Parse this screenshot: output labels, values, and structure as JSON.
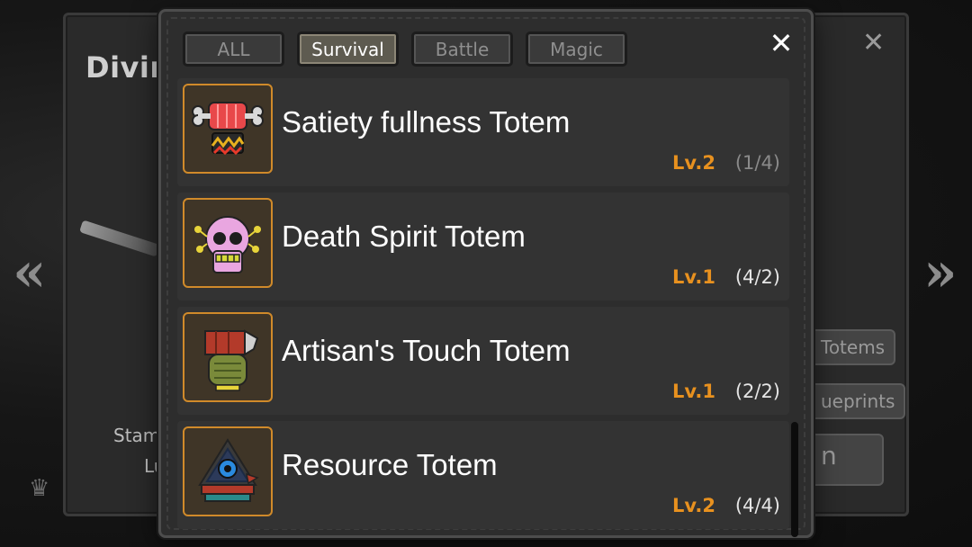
{
  "background": {
    "title": "Divin",
    "side_labels": [
      "Stam",
      "Lu"
    ],
    "buttons": [
      "Totems",
      "ueprints",
      "n"
    ]
  },
  "tabs": [
    {
      "label": "ALL",
      "active": false
    },
    {
      "label": "Survival",
      "active": true
    },
    {
      "label": "Battle",
      "active": false
    },
    {
      "label": "Magic",
      "active": false
    }
  ],
  "close_label": "✕",
  "items": [
    {
      "name": "Satiety fullness Totem",
      "level": "Lv.2",
      "count": "(1/4)",
      "count_dim": true,
      "icon": "meat-totem-icon"
    },
    {
      "name": "Death Spirit Totem",
      "level": "Lv.1",
      "count": "(4/2)",
      "count_dim": false,
      "icon": "skull-totem-icon"
    },
    {
      "name": "Artisan's Touch Totem",
      "level": "Lv.1",
      "count": "(2/2)",
      "count_dim": false,
      "icon": "hammer-totem-icon"
    },
    {
      "name": "Resource Totem",
      "level": "Lv.2",
      "count": "(4/4)",
      "count_dim": false,
      "icon": "triangle-totem-icon"
    }
  ],
  "colors": {
    "accent": "#e8911f",
    "active_tab": "#5e5b50",
    "icon_border": "#d08a2a"
  }
}
